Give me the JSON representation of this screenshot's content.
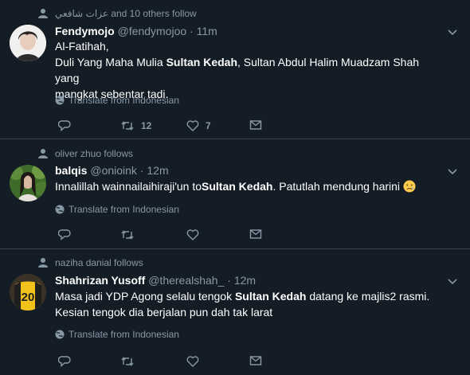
{
  "tweets": [
    {
      "context_text": "عزات شافعي and 10 others follow",
      "name": "Fendymojo",
      "handle": "@fendymojoo",
      "time": "11m",
      "lines": [
        {
          "parts": [
            "Al-Fatihah,"
          ]
        },
        {
          "parts": [
            "Duli Yang Maha Mulia ",
            "Sultan Kedah",
            ", Sultan Abdul Halim Muadzam Shah yang"
          ]
        },
        {
          "parts": [
            "mangkat sebentar tadi."
          ]
        }
      ],
      "translate": "Translate from Indonesian",
      "retweets": "12",
      "likes": "7"
    },
    {
      "context_text": "oliver zhuo follows",
      "name": "balqis",
      "handle": "@onioink",
      "time": "12m",
      "lines": [
        {
          "parts": [
            "Innalillah wainnailaihiraji'un to ",
            "Sultan Kedah",
            ". Patutlah mendung harini"
          ]
        }
      ],
      "emoji": "sad-face",
      "translate": "Translate from Indonesian",
      "retweets": "",
      "likes": ""
    },
    {
      "context_text": "naziha danial follows",
      "name": "Shahrizan Yusoff",
      "handle": "@therealshah_",
      "time": "12m",
      "lines": [
        {
          "parts": [
            "Masa jadi YDP Agong selalu tengok ",
            "Sultan Kedah",
            " datang ke majlis2 rasmi."
          ]
        },
        {
          "parts": [
            "Kesian tengok dia berjalan pun dah tak larat"
          ]
        }
      ],
      "translate": "Translate from Indonesian",
      "retweets": "",
      "likes": ""
    }
  ],
  "avatar_jersey_number": "20",
  "colors": {
    "background": "#141d26",
    "divider": "#38444d",
    "secondary_text": "#8899a6",
    "primary_text": "#ffffff"
  }
}
